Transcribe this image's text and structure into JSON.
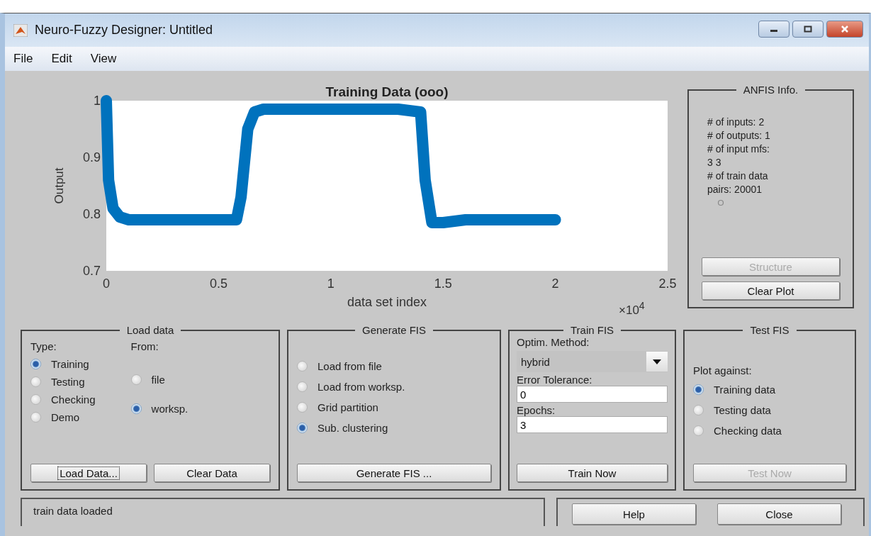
{
  "window": {
    "title": "Neuro-Fuzzy Designer: Untitled"
  },
  "menu": [
    "File",
    "Edit",
    "View"
  ],
  "plot": {
    "x_multiplier": "×10$^{4}$",
    "chart_data": {
      "type": "line",
      "title": "Training Data (ooo)",
      "xlabel": "data set index",
      "ylabel": "Output",
      "xlim": [
        0,
        2.5
      ],
      "ylim": [
        0.7,
        1.0
      ],
      "xticks": [
        0,
        0.5,
        1,
        1.5,
        2,
        2.5
      ],
      "yticks": [
        0.7,
        0.8,
        0.9,
        1
      ],
      "x": [
        0,
        0.01,
        0.03,
        0.06,
        0.1,
        0.2,
        0.3,
        0.4,
        0.5,
        0.58,
        0.6,
        0.63,
        0.66,
        0.7,
        0.8,
        0.9,
        1.0,
        1.1,
        1.2,
        1.3,
        1.4,
        1.42,
        1.45,
        1.5,
        1.6,
        1.7,
        1.8,
        1.9,
        2.0
      ],
      "series": [
        {
          "color": "#0072bd",
          "values": [
            1.0,
            0.86,
            0.81,
            0.795,
            0.79,
            0.79,
            0.79,
            0.79,
            0.79,
            0.79,
            0.83,
            0.95,
            0.98,
            0.985,
            0.985,
            0.985,
            0.985,
            0.985,
            0.985,
            0.985,
            0.98,
            0.86,
            0.785,
            0.785,
            0.79,
            0.79,
            0.79,
            0.79,
            0.79
          ]
        }
      ]
    }
  },
  "anfis_info": {
    "title": "ANFIS Info.",
    "lines": [
      "# of inputs: 2",
      "# of outputs: 1",
      "# of input mfs:",
      "3  3",
      "# of train data",
      "pairs: 20001"
    ],
    "buttons": [
      {
        "label": "Structure",
        "disabled": true
      },
      {
        "label": "Clear Plot",
        "disabled": false
      }
    ]
  },
  "load_data": {
    "title": "Load data",
    "type_label": "Type:",
    "from_label": "From:",
    "types": [
      {
        "label": "Training",
        "selected": true
      },
      {
        "label": "Testing",
        "selected": false
      },
      {
        "label": "Checking",
        "selected": false
      },
      {
        "label": "Demo",
        "selected": false
      }
    ],
    "sources": [
      {
        "label": "file",
        "selected": false
      },
      {
        "label": "worksp.",
        "selected": true
      }
    ],
    "buttons": [
      {
        "label": "Load Data...",
        "disabled": false,
        "focused": true
      },
      {
        "label": "Clear Data",
        "disabled": false,
        "focused": false
      }
    ]
  },
  "generate_fis": {
    "title": "Generate FIS",
    "options": [
      {
        "label": "Load from file",
        "selected": false
      },
      {
        "label": "Load from worksp.",
        "selected": false
      },
      {
        "label": "Grid partition",
        "selected": false
      },
      {
        "label": "Sub. clustering",
        "selected": true
      }
    ],
    "button": {
      "label": "Generate FIS ...",
      "disabled": false
    }
  },
  "train_fis": {
    "title": "Train FIS",
    "method_label": "Optim. Method:",
    "method": "hybrid",
    "tolerance_label": "Error Tolerance:",
    "tolerance": "0",
    "epochs_label": "Epochs:",
    "epochs": "3",
    "button": {
      "label": "Train Now",
      "disabled": false
    }
  },
  "test_fis": {
    "title": "Test FIS",
    "plot_label": "Plot against:",
    "options": [
      {
        "label": "Training data",
        "selected": true
      },
      {
        "label": "Testing data",
        "selected": false
      },
      {
        "label": "Checking data",
        "selected": false
      }
    ],
    "button": {
      "label": "Test Now",
      "disabled": true
    }
  },
  "status": "train data loaded",
  "footer_buttons": [
    "Help",
    "Close"
  ]
}
